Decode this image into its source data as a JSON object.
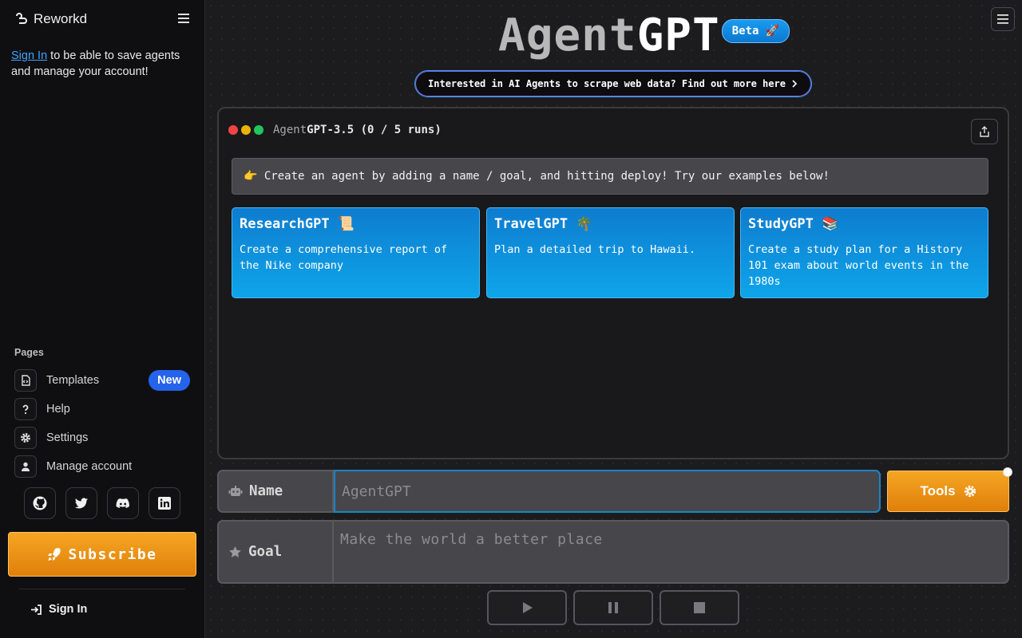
{
  "sidebar": {
    "brand": "Reworkd",
    "signin_link": "Sign In",
    "signin_note": " to be able to save agents and manage your account!",
    "pages_label": "Pages",
    "items": [
      {
        "label": "Templates",
        "icon": "document-code-icon",
        "badge": "New"
      },
      {
        "label": "Help",
        "icon": "question-icon"
      },
      {
        "label": "Settings",
        "icon": "gear-icon"
      },
      {
        "label": "Manage account",
        "icon": "user-icon"
      }
    ],
    "socials": [
      "github-icon",
      "twitter-icon",
      "discord-icon",
      "linkedin-icon"
    ],
    "subscribe_label": "Subscribe",
    "signin_label": "Sign In"
  },
  "hero": {
    "title_part1": "Agent",
    "title_part2": "GPT",
    "beta_label": "Beta 🚀",
    "promo_text": "Interested in AI Agents to scrape web data? Find out more here"
  },
  "window": {
    "model_part1": "Agent",
    "model_part2": "GPT-3.5",
    "runs": " (0 / 5 runs)",
    "hint": "👉 Create an agent by adding a name / goal, and hitting deploy! Try our examples below!",
    "cards": [
      {
        "title": "ResearchGPT 📜",
        "desc": "Create a comprehensive report of the Nike company"
      },
      {
        "title": "TravelGPT 🌴",
        "desc": "Plan a detailed trip to Hawaii."
      },
      {
        "title": "StudyGPT 📚",
        "desc": "Create a study plan for a History 101 exam about world events in the 1980s"
      }
    ]
  },
  "form": {
    "name_label": "Name",
    "name_placeholder": "AgentGPT",
    "goal_label": "Goal",
    "goal_placeholder": "Make the world a better place",
    "tools_label": "Tools"
  },
  "colors": {
    "accent_orange": "#f5a623",
    "accent_blue": "#0ea5ea",
    "link_blue": "#3ba4ff",
    "badge_blue": "#2563eb"
  }
}
